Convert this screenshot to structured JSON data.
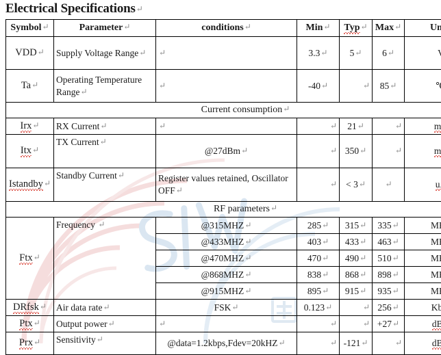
{
  "document": {
    "title": "Electrical Specifications",
    "paragraph_mark": "↵"
  },
  "table": {
    "headers": {
      "symbol": "Symbol",
      "parameter": "Parameter",
      "conditions": "conditions",
      "min": "Min",
      "typ": "Typ",
      "max": "Max",
      "units": "Units"
    },
    "sections": {
      "current_consumption": "Current consumption",
      "rf_parameters": "RF parameters"
    },
    "rows": [
      {
        "symbol": "VDD",
        "parameter": "Supply Voltage Range",
        "conditions": "",
        "min": "3.3",
        "typ": "5",
        "max": "6",
        "units": "V"
      },
      {
        "symbol": "Ta",
        "parameter": "Operating Temperature Range",
        "conditions": "",
        "min": "-40",
        "typ": "",
        "max": "85",
        "units": "℃"
      },
      {
        "symbol": "Irx",
        "parameter": "RX Current",
        "conditions": "",
        "min": "",
        "typ": "21",
        "max": "",
        "units": "mA"
      },
      {
        "symbol": "Itx",
        "parameter": "TX Current",
        "conditions": "@27dBm",
        "min": "",
        "typ": "350",
        "max": "",
        "units": "mA"
      },
      {
        "symbol": "Istandby",
        "parameter": "Standby Current",
        "conditions": "Register values retained, Oscillator OFF",
        "min": "",
        "typ": "< 3",
        "max": "",
        "units": "uA"
      },
      {
        "symbol": "Ftx",
        "parameter": "Frequency",
        "conditions": "@315MHZ",
        "min": "285",
        "typ": "315",
        "max": "335",
        "units": "MHZ"
      },
      {
        "symbol": "",
        "parameter": "",
        "conditions": "@433MHZ",
        "min": "403",
        "typ": "433",
        "max": "463",
        "units": "MHZ"
      },
      {
        "symbol": "",
        "parameter": "",
        "conditions": "@470MHZ",
        "min": "470",
        "typ": "490",
        "max": "510",
        "units": "MHZ"
      },
      {
        "symbol": "",
        "parameter": "",
        "conditions": "@868MHZ",
        "min": "838",
        "typ": "868",
        "max": "898",
        "units": "MHZ"
      },
      {
        "symbol": "",
        "parameter": "",
        "conditions": "@915MHZ",
        "min": "895",
        "typ": "915",
        "max": "935",
        "units": "MHZ"
      },
      {
        "symbol": "DRfsk",
        "parameter": "Air data rate",
        "conditions": "FSK",
        "min": "0.123",
        "typ": "",
        "max": "256",
        "units": "Kbps"
      },
      {
        "symbol": "Ptx",
        "parameter": "Output power",
        "conditions": "",
        "min": "",
        "typ": "",
        "max": "+27",
        "units": "dBm"
      },
      {
        "symbol": "Prx",
        "parameter": "Sensitivity",
        "conditions": "@data=1.2kbps,Fdev=20kHZ",
        "min": "",
        "typ": "-121",
        "max": "",
        "units": "dBm"
      }
    ]
  },
  "watermark": {
    "text": "SIW",
    "text_color": "#b9cfe4",
    "arc_color": "#edc9c9"
  },
  "colors": {
    "header_gray": "#c9c9c9",
    "border": "#000000",
    "text": "#1a1a1a",
    "pilcrow": "#8a8a8a"
  }
}
